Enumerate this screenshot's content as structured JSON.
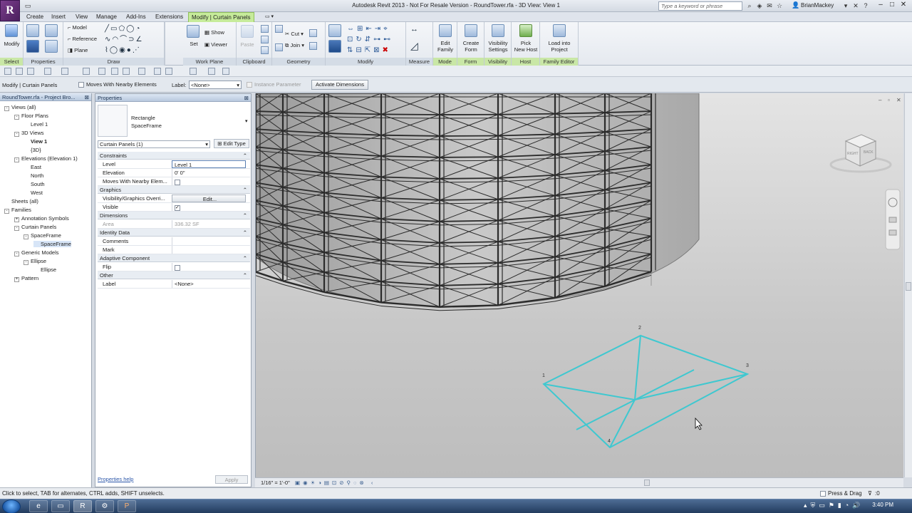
{
  "window": {
    "title": "Autodesk Revit 2013 -  Not For Resale Version -     RoundTower.rfa - 3D View: View 1",
    "search_placeholder": "Type a keyword or phrase",
    "user": "BrianMackey"
  },
  "tabs": [
    "Create",
    "Insert",
    "View",
    "Manage",
    "Add-Ins",
    "Extensions",
    "Modify | Curtain Panels"
  ],
  "ribbon": {
    "select": {
      "label": "Select",
      "modify": "Modify"
    },
    "properties": {
      "label": "Properties"
    },
    "draw": {
      "label": "Draw",
      "model": "Model",
      "reference": "Reference",
      "plane": "Plane"
    },
    "work_plane": {
      "label": "Work Plane",
      "set": "Set",
      "show": "Show",
      "viewer": "Viewer"
    },
    "clipboard": {
      "label": "Clipboard",
      "paste": "Paste"
    },
    "geometry": {
      "label": "Geometry",
      "cut": "Cut",
      "join": "Join"
    },
    "modify": {
      "label": "Modify"
    },
    "measure": {
      "label": "Measure"
    },
    "mode": {
      "label": "Mode",
      "edit_family_1": "Edit",
      "edit_family_2": "Family"
    },
    "form": {
      "label": "Form",
      "create_form_1": "Create",
      "create_form_2": "Form"
    },
    "visibility": {
      "label": "Visibility",
      "vis_settings_1": "Visibility",
      "vis_settings_2": "Settings"
    },
    "host": {
      "label": "Host",
      "pick_host_1": "Pick",
      "pick_host_2": "New Host"
    },
    "family_editor": {
      "label": "Family Editor",
      "load_1": "Load into",
      "load_2": "Project"
    }
  },
  "options_bar": {
    "context": "Modify | Curtain Panels",
    "moves_with": "Moves With Nearby Elements",
    "label_prefix": "Label:",
    "label_value": "<None>",
    "instance_param": "Instance Parameter",
    "activate_dimensions": "Activate Dimensions"
  },
  "browser": {
    "title": "RoundTower.rfa - Project Bro...",
    "items": [
      {
        "text": "Views (all)",
        "level": 0,
        "exp": "-"
      },
      {
        "text": "Floor Plans",
        "level": 1,
        "exp": "-"
      },
      {
        "text": "Level 1",
        "level": 2,
        "exp": ""
      },
      {
        "text": "3D Views",
        "level": 1,
        "exp": "-"
      },
      {
        "text": "View 1",
        "level": 2,
        "exp": "",
        "bold": true
      },
      {
        "text": "{3D}",
        "level": 2,
        "exp": ""
      },
      {
        "text": "Elevations (Elevation 1)",
        "level": 1,
        "exp": "-"
      },
      {
        "text": "East",
        "level": 2,
        "exp": ""
      },
      {
        "text": "North",
        "level": 2,
        "exp": ""
      },
      {
        "text": "South",
        "level": 2,
        "exp": ""
      },
      {
        "text": "West",
        "level": 2,
        "exp": ""
      },
      {
        "text": "Sheets (all)",
        "level": 0,
        "exp": ""
      },
      {
        "text": "Families",
        "level": 0,
        "exp": "-"
      },
      {
        "text": "Annotation Symbols",
        "level": 1,
        "exp": "+"
      },
      {
        "text": "Curtain Panels",
        "level": 1,
        "exp": "-"
      },
      {
        "text": "SpaceFrame",
        "level": 2,
        "exp": "-"
      },
      {
        "text": "SpaceFrame",
        "level": 3,
        "exp": "",
        "sel": true
      },
      {
        "text": "Generic Models",
        "level": 1,
        "exp": "-"
      },
      {
        "text": "Ellipse",
        "level": 2,
        "exp": "-"
      },
      {
        "text": "Ellipse",
        "level": 3,
        "exp": ""
      },
      {
        "text": "Pattern",
        "level": 1,
        "exp": "+"
      }
    ]
  },
  "properties": {
    "title": "Properties",
    "type_line1": "Rectangle",
    "type_line2": "SpaceFrame",
    "filter": "Curtain Panels (1)",
    "edit_type": "Edit Type",
    "groups": [
      {
        "name": "Constraints",
        "rows": [
          {
            "n": "Level",
            "v": "Level 1"
          },
          {
            "n": "Elevation",
            "v": "0'  0\""
          },
          {
            "n": "Moves With Nearby Elem...",
            "v": "",
            "check": false
          }
        ]
      },
      {
        "name": "Graphics",
        "rows": [
          {
            "n": "Visibility/Graphics Overri...",
            "v": "Edit..."
          },
          {
            "n": "Visible",
            "v": "",
            "check": true
          }
        ]
      },
      {
        "name": "Dimensions",
        "rows": [
          {
            "n": "Area",
            "v": "336.32 SF",
            "dim": true
          }
        ]
      },
      {
        "name": "Identity Data",
        "rows": [
          {
            "n": "Comments",
            "v": ""
          },
          {
            "n": "Mark",
            "v": ""
          }
        ]
      },
      {
        "name": "Adaptive Component",
        "rows": [
          {
            "n": "Flip",
            "v": "",
            "check": false
          }
        ]
      },
      {
        "name": "Other",
        "rows": [
          {
            "n": "Label",
            "v": "<None>"
          }
        ]
      }
    ],
    "help": "Properties help",
    "apply": "Apply"
  },
  "viewcube": {
    "right": "RIGHT",
    "back": "BACK"
  },
  "viewport": {
    "point_labels": [
      "1",
      "2",
      "3",
      "4"
    ],
    "scale": "1/16\" = 1'-0\""
  },
  "status": {
    "hint": "Click to select, TAB for alternates, CTRL adds, SHIFT unselects.",
    "press_drag": "Press & Drag",
    "filter_count": ":0"
  },
  "taskbar": {
    "clock": "3:40 PM"
  },
  "colors": {
    "accent_tab": "#c6eb9a",
    "panel_selection": "#3ec8d0",
    "frame": "#2b2b2b"
  }
}
